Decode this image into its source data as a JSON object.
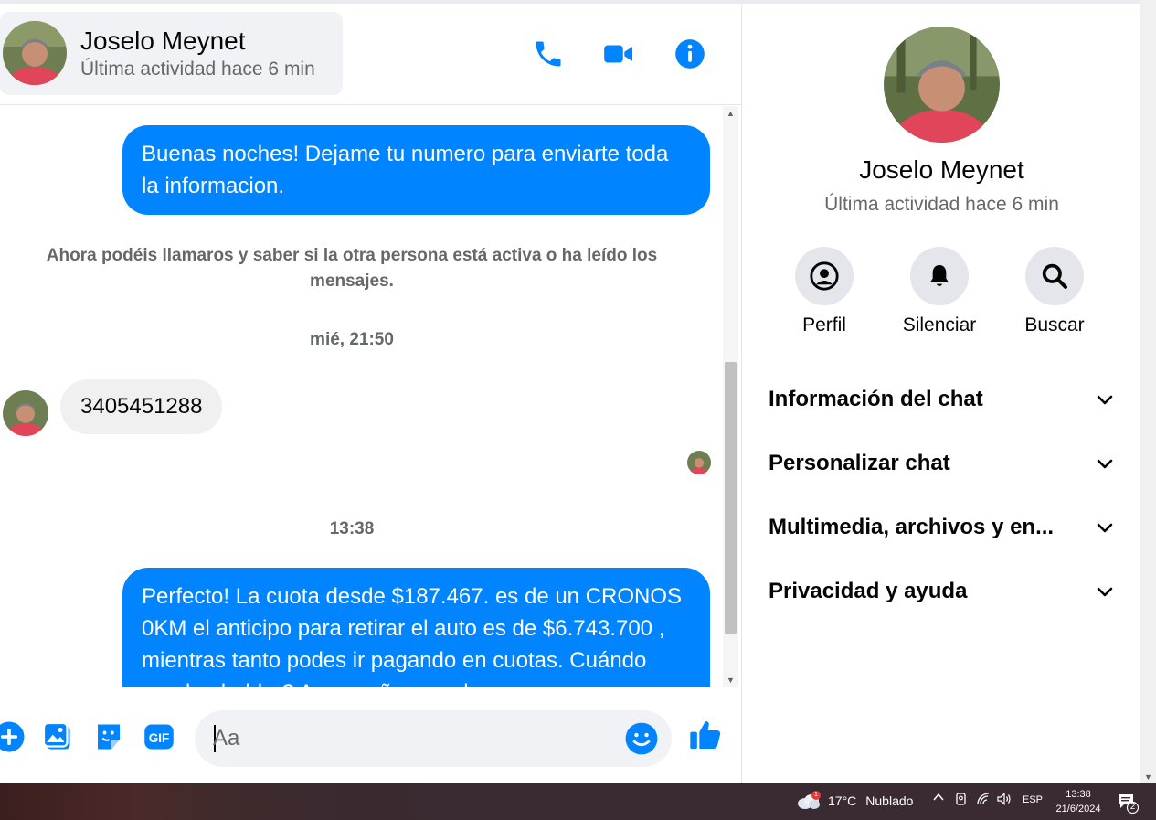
{
  "contact": {
    "name": "Joselo Meynet",
    "status": "Última actividad hace 6 min"
  },
  "messages": {
    "out1": "Buenas noches! Dejame tu numero para enviarte toda la informacion.",
    "system_note": "Ahora podéis llamaros y saber si la otra persona está activa o ha leído los mensajes.",
    "time1": "mié, 21:50",
    "in1": "3405451288",
    "time2": "13:38",
    "out2": "Perfecto! La cuota desde $187.467. es de un CRONOS 0KM el anticipo para retirar el auto es de $6.743.700 , mientras tanto podes ir pagando en cuotas. Cuándo pueden hablar? Acompañamos el"
  },
  "composer": {
    "placeholder": "Aa"
  },
  "info_panel": {
    "actions": [
      {
        "label": "Perfil",
        "icon": "profile-icon"
      },
      {
        "label": "Silenciar",
        "icon": "bell-icon"
      },
      {
        "label": "Buscar",
        "icon": "search-icon"
      }
    ],
    "sections": [
      "Información del chat",
      "Personalizar chat",
      "Multimedia, archivos y en...",
      "Privacidad y ayuda"
    ]
  },
  "taskbar": {
    "weather_temp": "17°C",
    "weather_desc": "Nublado",
    "weather_badge": "1",
    "language": "ESP",
    "time": "13:38",
    "date": "21/6/2024",
    "notifications": "2"
  },
  "colors": {
    "accent": "#0084ff",
    "incoming_bubble": "#f0f0f0",
    "secondary_text": "#65676b"
  }
}
